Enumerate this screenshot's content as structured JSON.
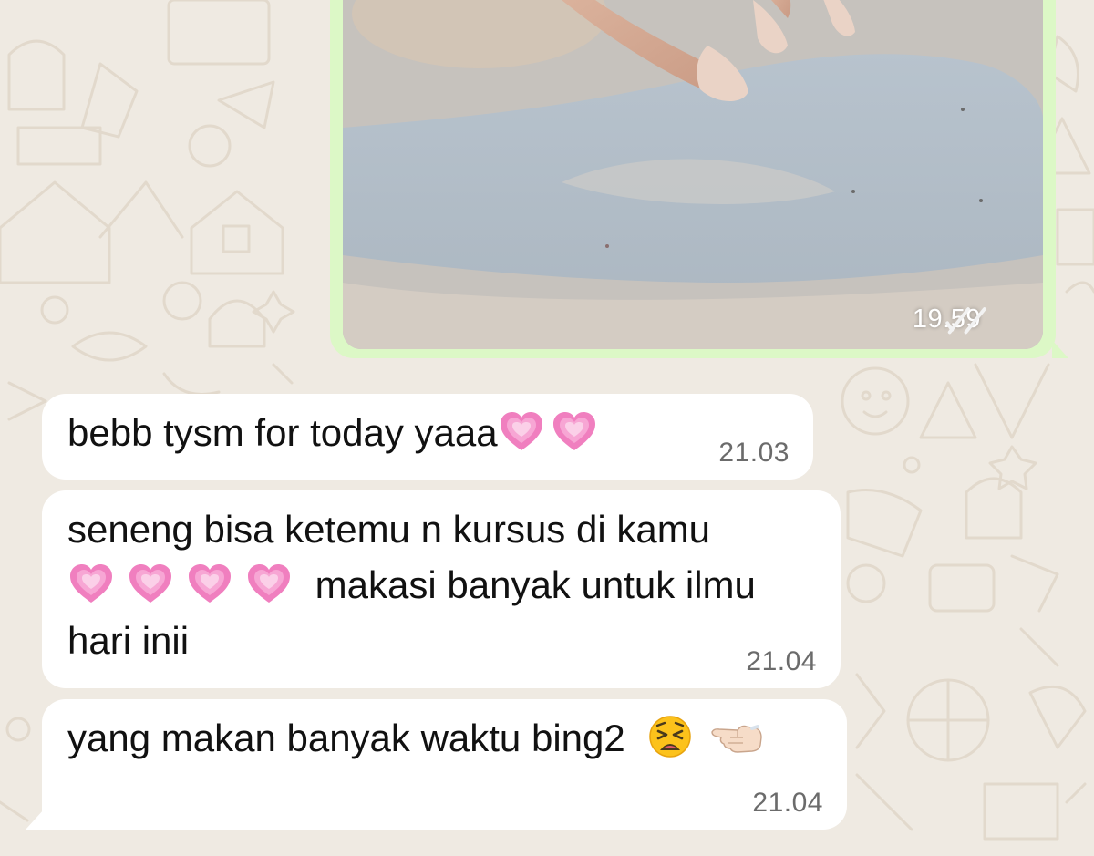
{
  "conversation": {
    "outgoing_image": {
      "time": "19.59",
      "status": "read",
      "status_icon": "double-check-icon"
    },
    "messages": [
      {
        "text": "bebb tysm for today yaaa",
        "emojis": [
          "growing-heart",
          "growing-heart"
        ],
        "time": "21.03"
      },
      {
        "text_line1": "seneng bisa ketemu n kursus di kamu",
        "emojis": [
          "growing-heart",
          "growing-heart",
          "growing-heart",
          "growing-heart"
        ],
        "text_line2": "makasi banyak untuk ilmu",
        "text_line3": "hari inii",
        "time": "21.04"
      },
      {
        "text": "yang makan banyak waktu bing2",
        "emojis": [
          "weary-face",
          "pointing-left-hand"
        ],
        "time": "21.04"
      }
    ]
  },
  "colors": {
    "chat_background": "#efeae2",
    "outgoing_bubble": "#dcf8c6",
    "incoming_bubble": "#ffffff",
    "timestamp": "#6b6b6b",
    "heart": "#f07fbf"
  }
}
